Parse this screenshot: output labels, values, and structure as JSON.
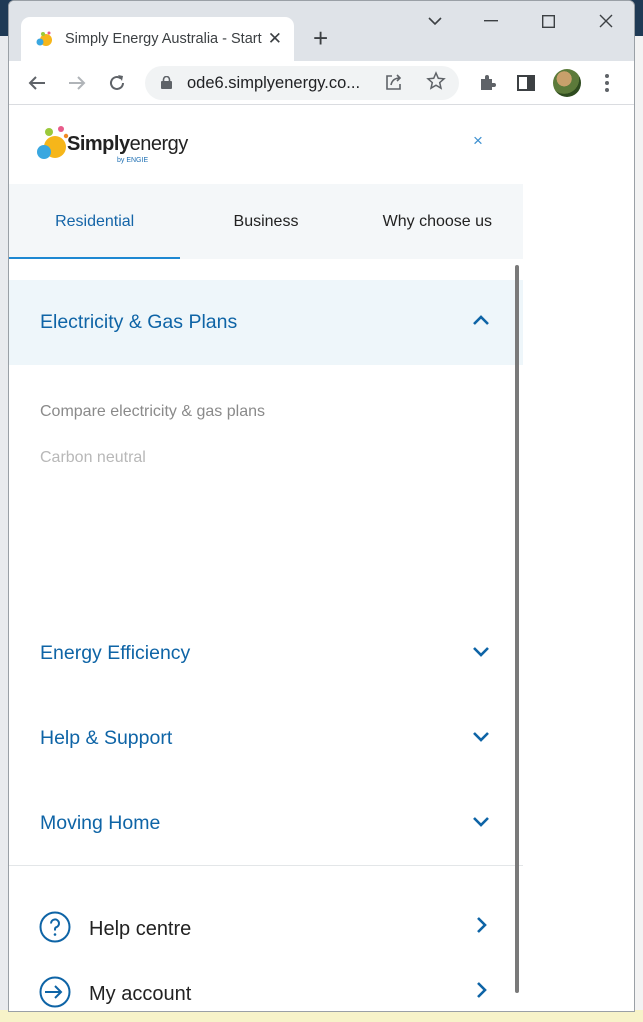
{
  "browser": {
    "tab_title": "Simply Energy Australia - Start",
    "url": "ode6.simplyenergy.co...",
    "new_tab": "+",
    "close_tab": "✕"
  },
  "logo": {
    "text_bold": "Simply",
    "text_regular": "energy",
    "sub": "by ENGIE"
  },
  "menu": {
    "close": "×",
    "tabs": [
      {
        "label": "Residential",
        "active": true
      },
      {
        "label": "Business",
        "active": false
      },
      {
        "label": "Why choose us",
        "active": false
      }
    ],
    "sections": [
      {
        "label": "Electricity & Gas Plans",
        "expanded": true
      },
      {
        "label": "Energy Efficiency",
        "expanded": false
      },
      {
        "label": "Help & Support",
        "expanded": false
      },
      {
        "label": "Moving Home",
        "expanded": false
      }
    ],
    "subitems": [
      {
        "label": "Compare electricity & gas plans",
        "color": "#8a8a8a"
      },
      {
        "label": "Carbon neutral",
        "color": "#b8b8b8"
      }
    ],
    "utility": [
      {
        "label": "Help centre",
        "icon": "question-circle-icon"
      },
      {
        "label": "My account",
        "icon": "arrow-circle-icon"
      }
    ]
  },
  "colors": {
    "brand_blue": "#0e64a6",
    "active_underline": "#1e88d2",
    "open_section_bg": "#eef6fa"
  }
}
